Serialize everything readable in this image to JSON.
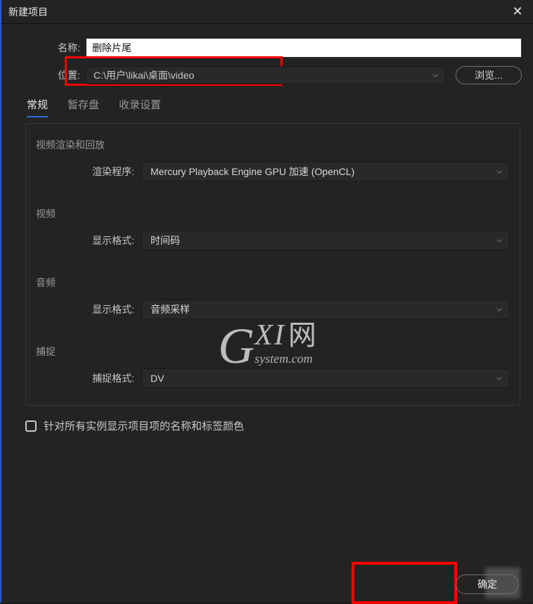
{
  "titlebar": {
    "title": "新建项目",
    "close_glyph": "✕"
  },
  "name": {
    "label": "名称:",
    "value": "删除片尾"
  },
  "location": {
    "label": "位置:",
    "value": "C:\\用户\\likai\\桌面\\video",
    "browse": "浏览..."
  },
  "tabs": {
    "general": "常规",
    "scratch": "暂存盘",
    "ingest": "收录设置"
  },
  "groups": {
    "render": {
      "title": "视频渲染和回放",
      "renderer_label": "渲染程序:",
      "renderer_value": "Mercury Playback Engine GPU 加速 (OpenCL)"
    },
    "video": {
      "title": "视频",
      "format_label": "显示格式:",
      "format_value": "时间码"
    },
    "audio": {
      "title": "音频",
      "format_label": "显示格式:",
      "format_value": "音频采样"
    },
    "capture": {
      "title": "捕捉",
      "format_label": "捕捉格式:",
      "format_value": "DV"
    }
  },
  "checkbox": {
    "label": "针对所有实例显示项目项的名称和标签颜色"
  },
  "footer": {
    "ok": "确定"
  },
  "watermark": {
    "g": "G",
    "xi": "XI",
    "cn": "网",
    "sys": "system.com"
  },
  "chevron": "⌵"
}
